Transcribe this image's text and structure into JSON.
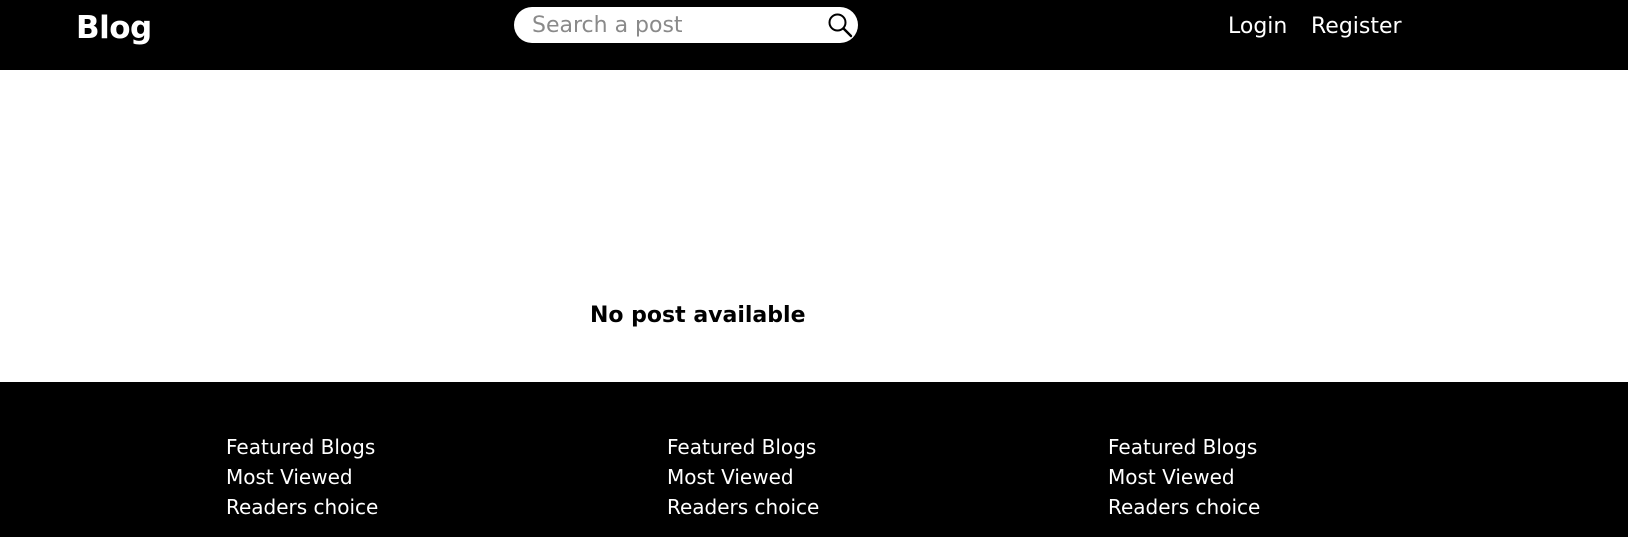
{
  "header": {
    "brand": "Blog",
    "search": {
      "placeholder": "Search a post",
      "value": "",
      "icon": "search-icon"
    },
    "nav": {
      "login": "Login",
      "register": "Register"
    }
  },
  "main": {
    "empty_message": "No post available"
  },
  "footer": {
    "columns": [
      {
        "links": [
          "Featured Blogs",
          "Most Viewed",
          "Readers choice"
        ]
      },
      {
        "links": [
          "Featured Blogs",
          "Most Viewed",
          "Readers choice"
        ]
      },
      {
        "links": [
          "Featured Blogs",
          "Most Viewed",
          "Readers choice"
        ]
      }
    ]
  },
  "colors": {
    "header_bg": "#000000",
    "footer_bg": "#000000",
    "page_bg": "#ffffff",
    "text_light": "#ffffff",
    "placeholder": "#8a8a8a"
  }
}
